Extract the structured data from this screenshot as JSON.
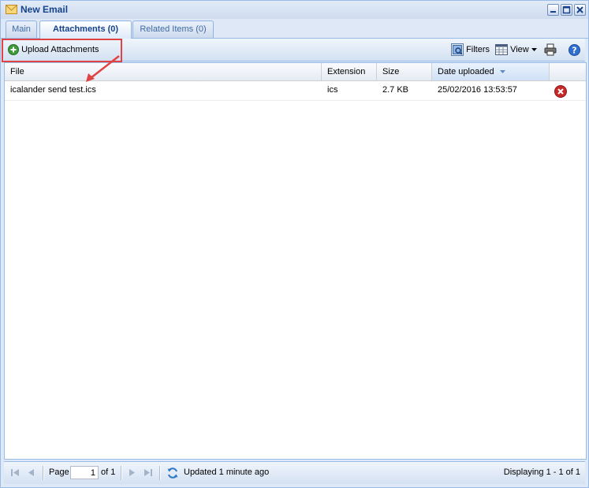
{
  "window": {
    "title": "New Email"
  },
  "tabs": [
    {
      "label": "Main",
      "active": false
    },
    {
      "label": "Attachments (0)",
      "active": true
    },
    {
      "label": "Related Items (0)",
      "active": false
    }
  ],
  "toolbar": {
    "upload_label": "Upload Attachments",
    "filters_label": "Filters",
    "view_label": "View"
  },
  "grid": {
    "columns": [
      "File",
      "Extension",
      "Size",
      "Date uploaded"
    ],
    "sorted_column": "Date uploaded",
    "rows": [
      {
        "file": "icalander send test.ics",
        "extension": "ics",
        "size": "2.7 KB",
        "date": "25/02/2016 13:53:57"
      }
    ]
  },
  "pager": {
    "page_label": "Page",
    "page_value": "1",
    "of_label": "of 1",
    "updated_text": "Updated 1 minute ago",
    "display_text": "Displaying 1 - 1 of 1"
  },
  "colors": {
    "accent": "#15428b",
    "highlight": "#e04343",
    "border": "#99bbe8"
  }
}
